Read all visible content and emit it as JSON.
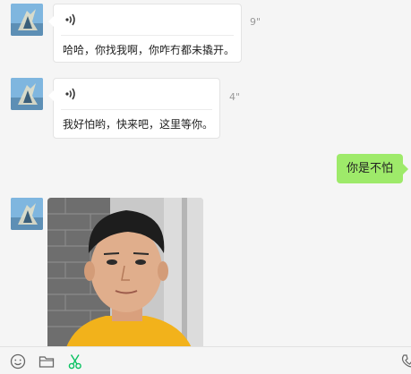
{
  "messages": [
    {
      "type": "voice",
      "direction": "incoming",
      "duration": "9\"",
      "transcript": "哈哈，你找我啊，你咋冇都未撬开。"
    },
    {
      "type": "voice",
      "direction": "incoming",
      "duration": "4\"",
      "transcript": "我好怕哟，快来吧，这里等你。"
    },
    {
      "type": "text",
      "direction": "outgoing",
      "text": "你是不怕"
    },
    {
      "type": "image",
      "direction": "incoming"
    }
  ],
  "colors": {
    "outgoing_bubble": "#9eea6a",
    "incoming_bubble": "#ffffff",
    "background": "#f5f5f5",
    "accent": "#07c160"
  },
  "toolbar": {
    "icons": [
      "emoji-icon",
      "folder-icon",
      "scissors-icon",
      "phone-icon"
    ]
  }
}
